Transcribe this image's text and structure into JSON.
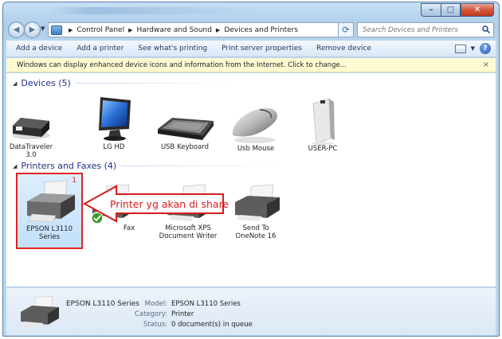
{
  "address": {
    "crumbs": [
      "Control Panel",
      "Hardware and Sound",
      "Devices and Printers"
    ],
    "search_placeholder": "Search Devices and Printers"
  },
  "toolbar": {
    "items": [
      "Add a device",
      "Add a printer",
      "See what's printing",
      "Print server properties",
      "Remove device"
    ]
  },
  "infobar": {
    "text": "Windows can display enhanced device icons and information from the Internet. Click to change...",
    "close": "×"
  },
  "groups": {
    "devices": {
      "title": "Devices (5)",
      "items": [
        "DataTraveler 3.0",
        "LG HD",
        "USB Keyboard",
        "Usb Mouse",
        "USER-PC"
      ]
    },
    "printers": {
      "title": "Printers and Faxes (4)",
      "selected": {
        "line1": "EPSON L3110",
        "line2": "Series",
        "badge": "1"
      },
      "fax": "Fax",
      "xps": {
        "line1": "Microsoft XPS",
        "line2": "Document Writer"
      },
      "onenote": {
        "line1": "Send To",
        "line2": "OneNote 16"
      }
    }
  },
  "annotation": {
    "text": "Printer yg akan di share",
    "color": "#d61c1c"
  },
  "details": {
    "name": "EPSON L3110 Series",
    "model_label": "Model:",
    "model": "EPSON L3110 Series",
    "category_label": "Category:",
    "category": "Printer",
    "status_label": "Status:",
    "status": "0 document(s) in queue"
  },
  "icons": [
    "back-arrow-icon",
    "forward-arrow-icon",
    "refresh-icon",
    "search-icon",
    "help-icon",
    "close-icon",
    "check-icon"
  ],
  "colors": {
    "accent": "#1e3287",
    "selection_border": "#e32222",
    "infobar": "#fefbd2"
  }
}
